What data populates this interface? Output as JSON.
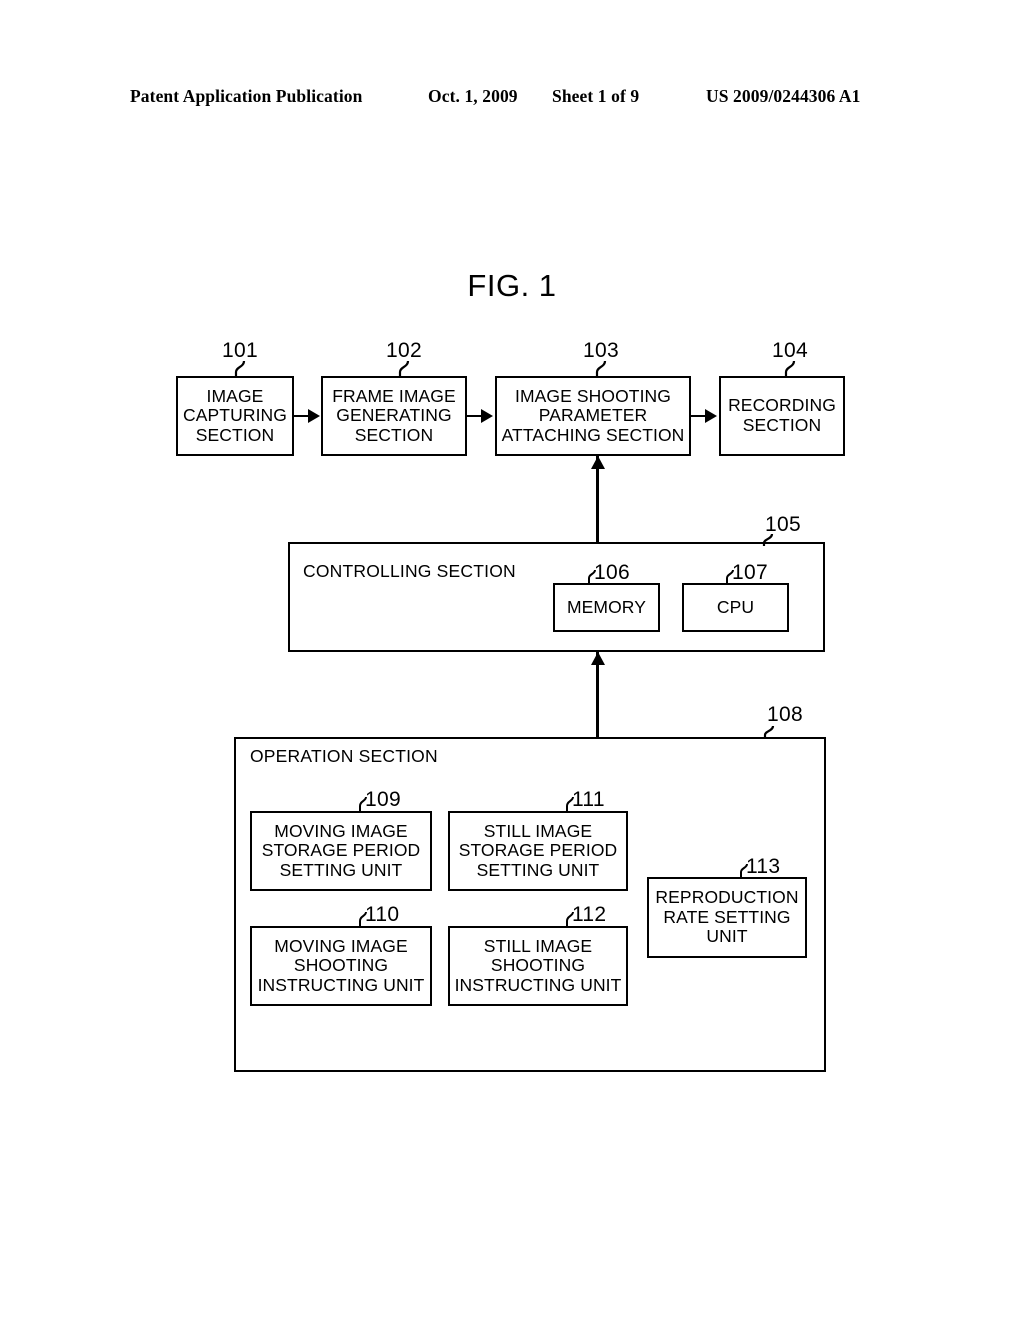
{
  "header": {
    "publication": "Patent Application Publication",
    "date": "Oct. 1, 2009",
    "sheet": "Sheet 1 of 9",
    "patent_number": "US 2009/0244306 A1"
  },
  "figure": {
    "title": "FIG. 1",
    "blocks": [
      {
        "ref": "101",
        "label": "IMAGE\nCAPTURING\nSECTION"
      },
      {
        "ref": "102",
        "label": "FRAME IMAGE\nGENERATING\nSECTION"
      },
      {
        "ref": "103",
        "label": "IMAGE SHOOTING\nPARAMETER\nATTACHING SECTION"
      },
      {
        "ref": "104",
        "label": "RECORDING\nSECTION"
      },
      {
        "ref": "105",
        "label": "CONTROLLING SECTION"
      },
      {
        "ref": "106",
        "label": "MEMORY"
      },
      {
        "ref": "107",
        "label": "CPU"
      },
      {
        "ref": "108",
        "label": "OPERATION SECTION"
      },
      {
        "ref": "109",
        "label": "MOVING IMAGE\nSTORAGE PERIOD\nSETTING UNIT"
      },
      {
        "ref": "110",
        "label": "MOVING IMAGE\nSHOOTING\nINSTRUCTING UNIT"
      },
      {
        "ref": "111",
        "label": "STILL IMAGE\nSTORAGE PERIOD\nSETTING UNIT"
      },
      {
        "ref": "112",
        "label": "STILL IMAGE\nSHOOTING\nINSTRUCTING UNIT"
      },
      {
        "ref": "113",
        "label": "REPRODUCTION\nRATE SETTING\nUNIT"
      }
    ],
    "connections": [
      {
        "from": "101",
        "to": "102",
        "direction": "right"
      },
      {
        "from": "102",
        "to": "103",
        "direction": "right"
      },
      {
        "from": "103",
        "to": "104",
        "direction": "right"
      },
      {
        "from": "105",
        "to": "103",
        "direction": "up"
      },
      {
        "from": "108",
        "to": "105",
        "direction": "up"
      }
    ]
  },
  "colors": {
    "ink": "#000000",
    "paper": "#ffffff"
  }
}
